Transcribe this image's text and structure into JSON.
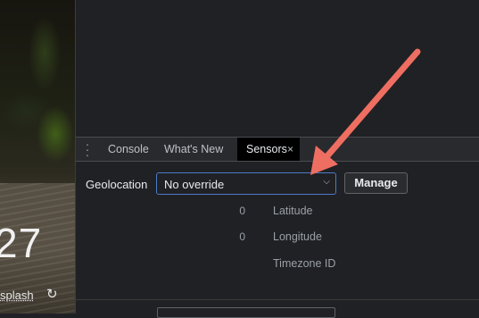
{
  "background": {
    "clock_text": "27",
    "credit_text": "splash",
    "refresh_icon": "refresh-icon"
  },
  "drawer": {
    "tabs": [
      {
        "label": "Console"
      },
      {
        "label": "What's New"
      },
      {
        "label": "Sensors",
        "active": true
      }
    ],
    "close_glyph": "×"
  },
  "sensors": {
    "geolocation_label": "Geolocation",
    "location_select": {
      "selected": "No override"
    },
    "manage_label": "Manage",
    "latitude": {
      "value": "0",
      "label": "Latitude"
    },
    "longitude": {
      "value": "0",
      "label": "Longitude"
    },
    "timezone": {
      "label": "Timezone ID"
    }
  },
  "colors": {
    "annotation_arrow": "#ef6e62",
    "select_border": "#4d7ac7",
    "panel_bg": "#202124"
  }
}
